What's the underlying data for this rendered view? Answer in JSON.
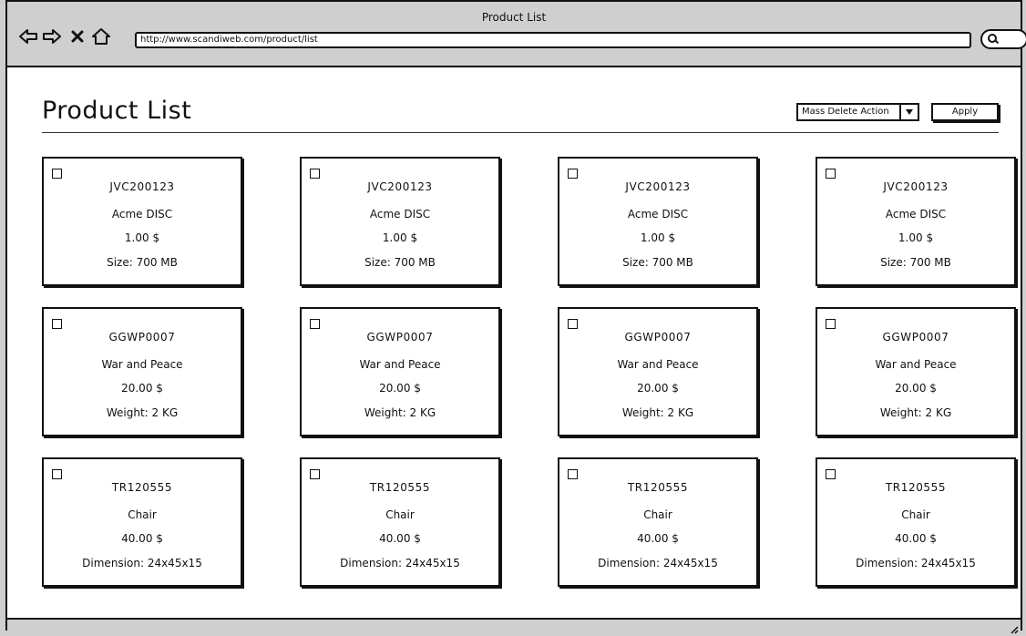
{
  "window": {
    "title": "Product List"
  },
  "browser": {
    "url": "http://www.scandiweb.com/product/list",
    "icons": [
      "back-arrow-icon",
      "forward-arrow-icon",
      "close-icon",
      "home-icon",
      "search-icon"
    ]
  },
  "page": {
    "title": "Product List",
    "mass_action": {
      "selected": "Mass Delete Action",
      "apply_label": "Apply"
    }
  },
  "products": [
    {
      "sku": "JVC200123",
      "name": "Acme DISC",
      "price": "1.00 $",
      "attr": "Size: 700 MB"
    },
    {
      "sku": "JVC200123",
      "name": "Acme DISC",
      "price": "1.00 $",
      "attr": "Size: 700 MB"
    },
    {
      "sku": "JVC200123",
      "name": "Acme DISC",
      "price": "1.00 $",
      "attr": "Size: 700 MB"
    },
    {
      "sku": "JVC200123",
      "name": "Acme DISC",
      "price": "1.00 $",
      "attr": "Size: 700 MB"
    },
    {
      "sku": "GGWP0007",
      "name": "War and Peace",
      "price": "20.00 $",
      "attr": "Weight: 2 KG"
    },
    {
      "sku": "GGWP0007",
      "name": "War and Peace",
      "price": "20.00 $",
      "attr": "Weight: 2 KG"
    },
    {
      "sku": "GGWP0007",
      "name": "War and Peace",
      "price": "20.00 $",
      "attr": "Weight: 2 KG"
    },
    {
      "sku": "GGWP0007",
      "name": "War and Peace",
      "price": "20.00 $",
      "attr": "Weight: 2 KG"
    },
    {
      "sku": "TR120555",
      "name": "Chair",
      "price": "40.00 $",
      "attr": "Dimension: 24x45x15"
    },
    {
      "sku": "TR120555",
      "name": "Chair",
      "price": "40.00 $",
      "attr": "Dimension: 24x45x15"
    },
    {
      "sku": "TR120555",
      "name": "Chair",
      "price": "40.00 $",
      "attr": "Dimension: 24x45x15"
    },
    {
      "sku": "TR120555",
      "name": "Chair",
      "price": "40.00 $",
      "attr": "Dimension: 24x45x15"
    }
  ]
}
